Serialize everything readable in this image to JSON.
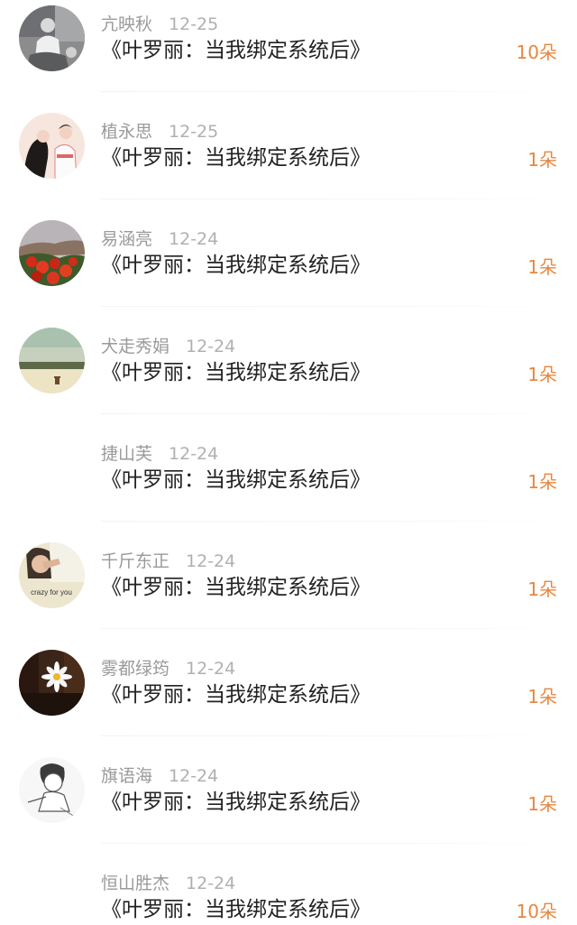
{
  "gift_list": {
    "items": [
      {
        "name": "亢映秋",
        "date": "12-25",
        "title": "《叶罗丽：当我绑定系统后》",
        "count": "10朵",
        "avatar": "photo-person-sitting"
      },
      {
        "name": "植永思",
        "date": "12-25",
        "title": "《叶罗丽：当我绑定系统后》",
        "count": "1朵",
        "avatar": "illustration-couple"
      },
      {
        "name": "易涵亮",
        "date": "12-24",
        "title": "《叶罗丽：当我绑定系统后》",
        "count": "1朵",
        "avatar": "photo-red-flowers"
      },
      {
        "name": "犬走秀娟",
        "date": "12-24",
        "title": "《叶罗丽：当我绑定系统后》",
        "count": "1朵",
        "avatar": "photo-landscape-chair"
      },
      {
        "name": "捷山芙",
        "date": "12-24",
        "title": "《叶罗丽：当我绑定系统后》",
        "count": "1朵",
        "avatar": "none"
      },
      {
        "name": "千斤东正",
        "date": "12-24",
        "title": "《叶罗丽：当我绑定系统后》",
        "count": "1朵",
        "avatar": "photo-crazy-for-you",
        "avatar_caption": "crazy for you"
      },
      {
        "name": "雾都绿筠",
        "date": "12-24",
        "title": "《叶罗丽：当我绑定系统后》",
        "count": "1朵",
        "avatar": "photo-daisy"
      },
      {
        "name": "旗语海",
        "date": "12-24",
        "title": "《叶罗丽：当我绑定系统后》",
        "count": "1朵",
        "avatar": "sketch-boy"
      },
      {
        "name": "恒山胜杰",
        "date": "12-24",
        "title": "《叶罗丽：当我绑定系统后》",
        "count": "10朵",
        "avatar": "none"
      }
    ]
  },
  "colors": {
    "name": "#9a9a9a",
    "date": "#b0b0b0",
    "title": "#222222",
    "count": "#e8873f",
    "divider": "#f3f3f3"
  }
}
